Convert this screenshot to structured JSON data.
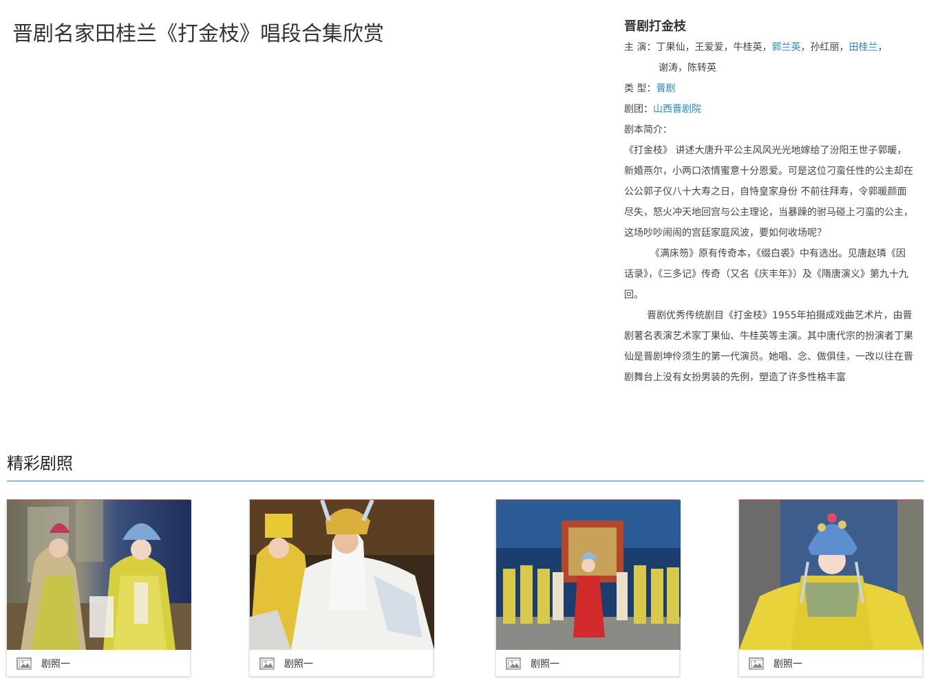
{
  "page": {
    "title": "晋剧名家田桂兰《打金枝》唱段合集欣赏"
  },
  "info": {
    "play_name": "晋剧打金枝",
    "cast_label": "主 演：",
    "cast": [
      {
        "name": "丁果仙",
        "link": false
      },
      {
        "name": "王爱爱",
        "link": false
      },
      {
        "name": "牛桂英",
        "link": false
      },
      {
        "name": "郭兰英",
        "link": true
      },
      {
        "name": "孙红丽",
        "link": false
      },
      {
        "name": "田桂兰",
        "link": true
      },
      {
        "name": "谢涛",
        "link": false
      },
      {
        "name": "陈转英",
        "link": false
      }
    ],
    "genre_label": "类 型：",
    "genre": "晋剧",
    "troupe_label": "剧团：",
    "troupe": "山西晋剧院",
    "synopsis_label": "剧本简介：",
    "synopsis": [
      "《打金枝》 讲述大唐升平公主风风光光地嫁给了汾阳王世子郭暖，新婚燕尔，小两口浓情蜜意十分恩爱。可是这位刁蛮任性的公主却在公公郭子仪八十大寿之日，自恃皇家身份 不前往拜寿，令郭暖颜面尽失，怒火冲天地回宫与公主理论，当暴躁的驸马碰上刁蛮的公主，这场吵吵闹闹的宫廷家庭风波，要如何收场呢？",
      "《满床笏》原有传奇本，《缀白裘》中有选出。见唐赵璘《因话录》，《三多记》传奇（又名《庆丰年》）及《隋唐演义》第九十九回。",
      "晋剧优秀传统剧目《打金枝》1955年拍摄成戏曲艺术片，由晋剧著名表演艺术家丁果仙、牛桂英等主演。其中唐代宗的扮演者丁果仙是晋剧坤伶须生的第一代演员。她唱、念、做俱佳，一改以往在晋剧舞台上没有女扮男装的先例，塑造了许多性格丰富"
    ]
  },
  "gallery": {
    "title": "精彩剧照",
    "accent_color": "#1f8ad8",
    "photos": [
      {
        "caption": "剧照一",
        "icon": "image-icon"
      },
      {
        "caption": "剧照一",
        "icon": "image-icon"
      },
      {
        "caption": "剧照一",
        "icon": "image-icon"
      },
      {
        "caption": "剧照一",
        "icon": "image-icon"
      }
    ]
  }
}
